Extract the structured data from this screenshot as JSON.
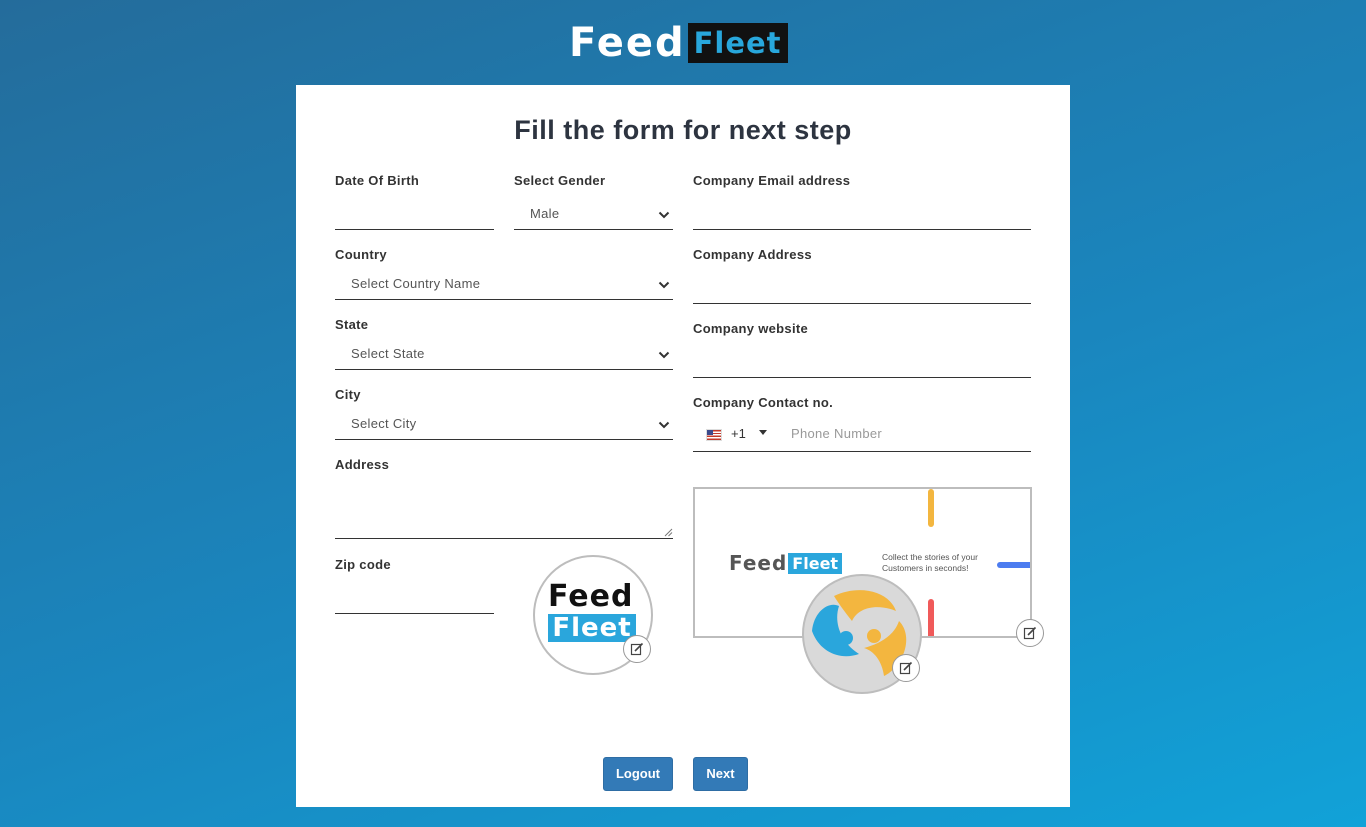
{
  "brand": {
    "part1": "Feed",
    "part2": "Fleet"
  },
  "form": {
    "title": "Fill the form for next step",
    "dob": {
      "label": "Date Of Birth",
      "value": ""
    },
    "gender": {
      "label": "Select Gender",
      "selected": "Male"
    },
    "country": {
      "label": "Country",
      "selected": "Select Country Name"
    },
    "state": {
      "label": "State",
      "selected": "Select State"
    },
    "city": {
      "label": "City",
      "selected": "Select City"
    },
    "address": {
      "label": "Address",
      "value": ""
    },
    "zip": {
      "label": "Zip code",
      "value": ""
    },
    "company_email": {
      "label": "Company Email address",
      "value": ""
    },
    "company_address": {
      "label": "Company Address",
      "value": ""
    },
    "company_website": {
      "label": "Company website",
      "value": ""
    },
    "company_contact": {
      "label": "Company Contact no.",
      "dial_code": "+1",
      "placeholder": "Phone Number",
      "flag": "us-flag-icon"
    }
  },
  "profile_image": {
    "line1": "Feed",
    "line2": "Fleet"
  },
  "cover_image": {
    "logo_part1": "Feed",
    "logo_part2": "Fleet",
    "tagline": "Collect the stories of your Customers in seconds!"
  },
  "buttons": {
    "logout": "Logout",
    "next": "Next"
  },
  "colors": {
    "accent": "#337ab7",
    "brand_blue": "#2aa6dc",
    "orange": "#f3b63f"
  }
}
